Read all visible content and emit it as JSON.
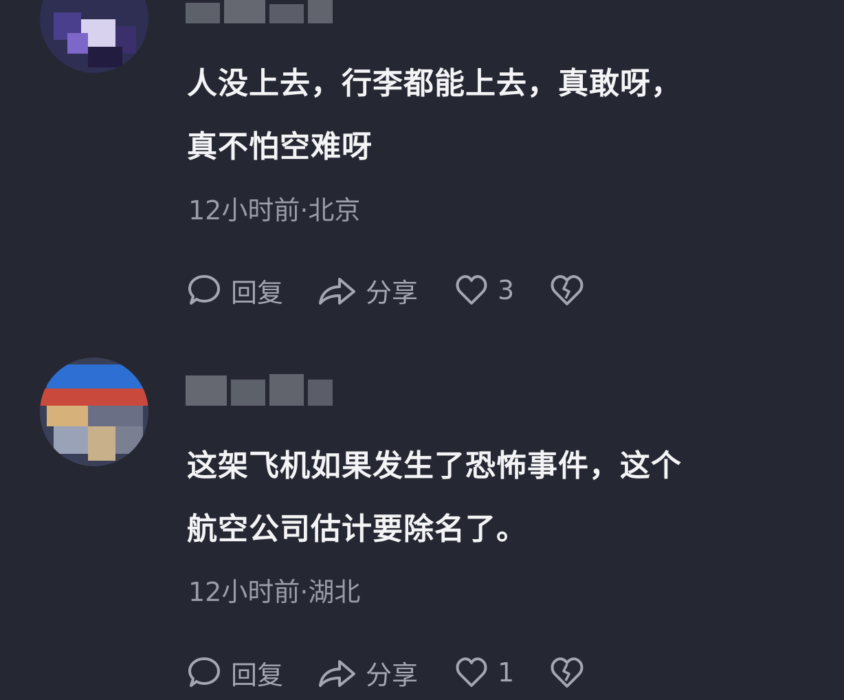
{
  "comments": [
    {
      "text_line1": "人没上去，行李都能上去，真敢呀，",
      "text_line2": "真不怕空难呀",
      "meta": "12小时前·北京",
      "reply_label": "回复",
      "share_label": "分享",
      "like_count": "3"
    },
    {
      "text_line1": "这架飞机如果发生了恐怖事件，这个",
      "text_line2": "航空公司估计要除名了。",
      "meta": "12小时前·湖北",
      "reply_label": "回复",
      "share_label": "分享",
      "like_count": "1"
    }
  ],
  "icons": {
    "reply": "comment-bubble-icon",
    "share": "share-arrow-icon",
    "like": "heart-icon",
    "dislike": "broken-heart-icon"
  },
  "colors": {
    "background": "#252833",
    "text": "#f4f4f6",
    "meta": "#9a9ca6",
    "action": "#a4a6b0"
  }
}
